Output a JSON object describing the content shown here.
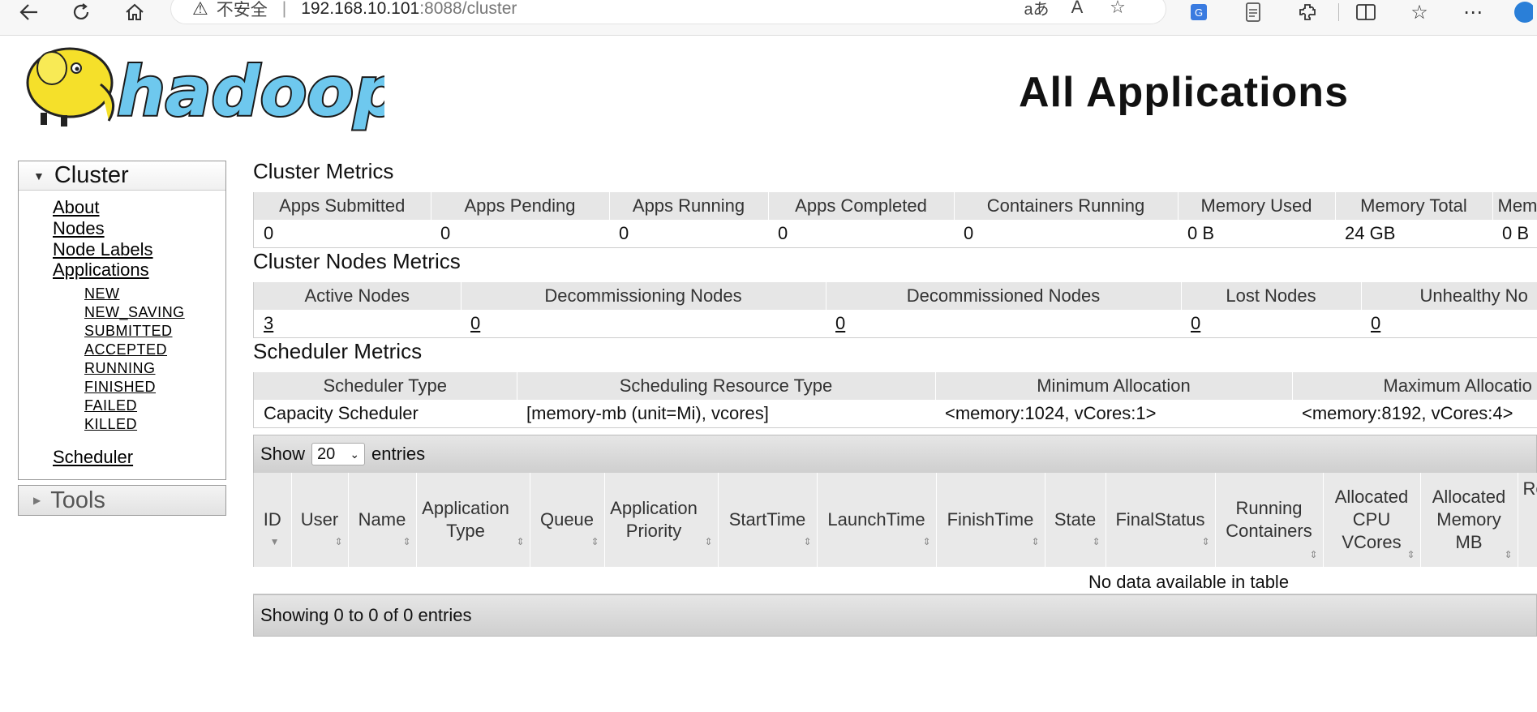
{
  "browser": {
    "security_label": "不安全",
    "url_host": "192.168.10.101",
    "url_path": ":8088/cluster",
    "read_aloud_label": "aあ",
    "reader_label": "A"
  },
  "header": {
    "title": "All Applications"
  },
  "sidebar": {
    "cluster_label": "Cluster",
    "links": [
      "About",
      "Nodes",
      "Node Labels",
      "Applications"
    ],
    "app_states": [
      "NEW",
      "NEW_SAVING",
      "SUBMITTED",
      "ACCEPTED",
      "RUNNING",
      "FINISHED",
      "FAILED",
      "KILLED"
    ],
    "scheduler_label": "Scheduler",
    "tools_label": "Tools"
  },
  "cluster_metrics": {
    "title": "Cluster Metrics",
    "headers": [
      "Apps Submitted",
      "Apps Pending",
      "Apps Running",
      "Apps Completed",
      "Containers Running",
      "Memory Used",
      "Memory Total",
      "Memo"
    ],
    "values": [
      "0",
      "0",
      "0",
      "0",
      "0",
      "0 B",
      "24 GB",
      "0 B"
    ]
  },
  "nodes_metrics": {
    "title": "Cluster Nodes Metrics",
    "headers": [
      "Active Nodes",
      "Decommissioning Nodes",
      "Decommissioned Nodes",
      "Lost Nodes",
      "Unhealthy No"
    ],
    "values": [
      "3",
      "0",
      "0",
      "0",
      "0"
    ]
  },
  "scheduler_metrics": {
    "title": "Scheduler Metrics",
    "headers": [
      "Scheduler Type",
      "Scheduling Resource Type",
      "Minimum Allocation",
      "Maximum Allocatio"
    ],
    "values": [
      "Capacity Scheduler",
      "[memory-mb (unit=Mi), vcores]",
      "<memory:1024, vCores:1>",
      "<memory:8192, vCores:4>"
    ]
  },
  "entries": {
    "show_label": "Show",
    "page_size": "20",
    "entries_label": "entries",
    "showing_text": "Showing 0 to 0 of 0 entries"
  },
  "apps_table": {
    "headers": [
      "ID",
      "User",
      "Name",
      "Application Type",
      "Queue",
      "Application Priority",
      "StartTime",
      "LaunchTime",
      "FinishTime",
      "State",
      "FinalStatus",
      "Running Containers",
      "Allocated CPU VCores",
      "Allocated Memory MB",
      "Re"
    ],
    "empty_text": "No data available in table"
  }
}
